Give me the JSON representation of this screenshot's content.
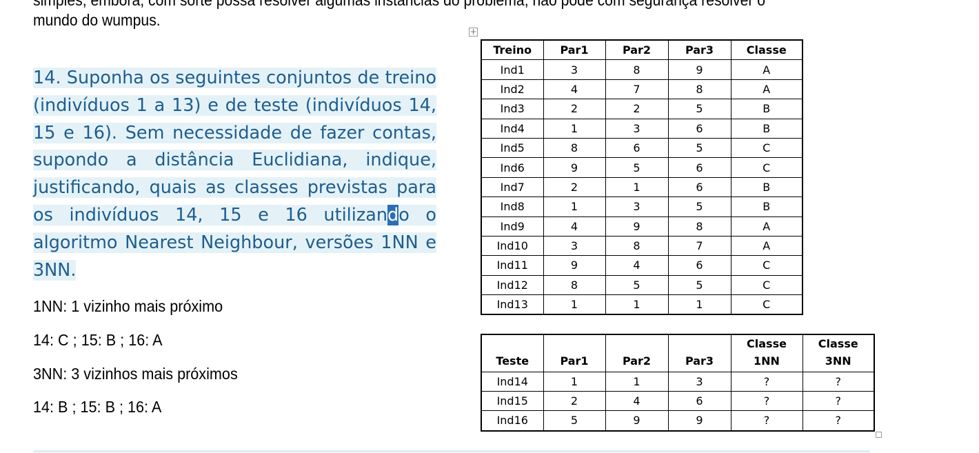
{
  "document": {
    "clipped_line": "simples, embora, com sorte possa resolver algumas instâncias do problema, não pode com segurança resolver o",
    "prev_paragraph_end": "mundo do wumpus.",
    "question": {
      "text_before_caret": "14. Suponha os seguintes conjuntos de treino (indivíduos 1 a 13) e de teste (indivíduos 14, 15 e 16). Sem necessidade de fazer contas, supondo a distância Euclidiana, indique, justificando, quais as classes previstas para os indivíduos 14, 15 e 16 utilizan",
      "caret_char": "d",
      "text_after_caret": "o o algoritmo Nearest Neighbour, versões 1NN e 3NN."
    },
    "answers": [
      "1NN: 1 vizinho mais próximo",
      "14: C  ;  15: B  ; 16: A",
      "3NN: 3 vizinhos mais próximos",
      "14: B  ; 15: B  ; 16: A"
    ]
  },
  "train_table": {
    "headers": [
      "Treino",
      "Par1",
      "Par2",
      "Par3",
      "Classe"
    ],
    "rows": [
      [
        "Ind1",
        "3",
        "8",
        "9",
        "A"
      ],
      [
        "Ind2",
        "4",
        "7",
        "8",
        "A"
      ],
      [
        "Ind3",
        "2",
        "2",
        "5",
        "B"
      ],
      [
        "Ind4",
        "1",
        "3",
        "6",
        "B"
      ],
      [
        "Ind5",
        "8",
        "6",
        "5",
        "C"
      ],
      [
        "Ind6",
        "9",
        "5",
        "6",
        "C"
      ],
      [
        "Ind7",
        "2",
        "1",
        "6",
        "B"
      ],
      [
        "Ind8",
        "1",
        "3",
        "5",
        "B"
      ],
      [
        "Ind9",
        "4",
        "9",
        "8",
        "A"
      ],
      [
        "Ind10",
        "3",
        "8",
        "7",
        "A"
      ],
      [
        "Ind11",
        "9",
        "4",
        "6",
        "C"
      ],
      [
        "Ind12",
        "8",
        "5",
        "5",
        "C"
      ],
      [
        "Ind13",
        "1",
        "1",
        "1",
        "C"
      ]
    ]
  },
  "test_table": {
    "headers": [
      "Teste",
      "Par1",
      "Par2",
      "Par3",
      "Classe\n1NN",
      "Classe\n3NN"
    ],
    "rows": [
      [
        "Ind14",
        "1",
        "1",
        "3",
        "?",
        "?"
      ],
      [
        "Ind15",
        "2",
        "4",
        "6",
        "?",
        "?"
      ],
      [
        "Ind16",
        "5",
        "9",
        "9",
        "?",
        "?"
      ]
    ]
  },
  "icons": {
    "table_move_handle": "move-icon",
    "table_resize_handle": "resize-handle-icon"
  },
  "colors": {
    "question_text": "#1f5d8f",
    "selection_highlight": "#e4f2f7",
    "caret": "#2b6fb3"
  }
}
